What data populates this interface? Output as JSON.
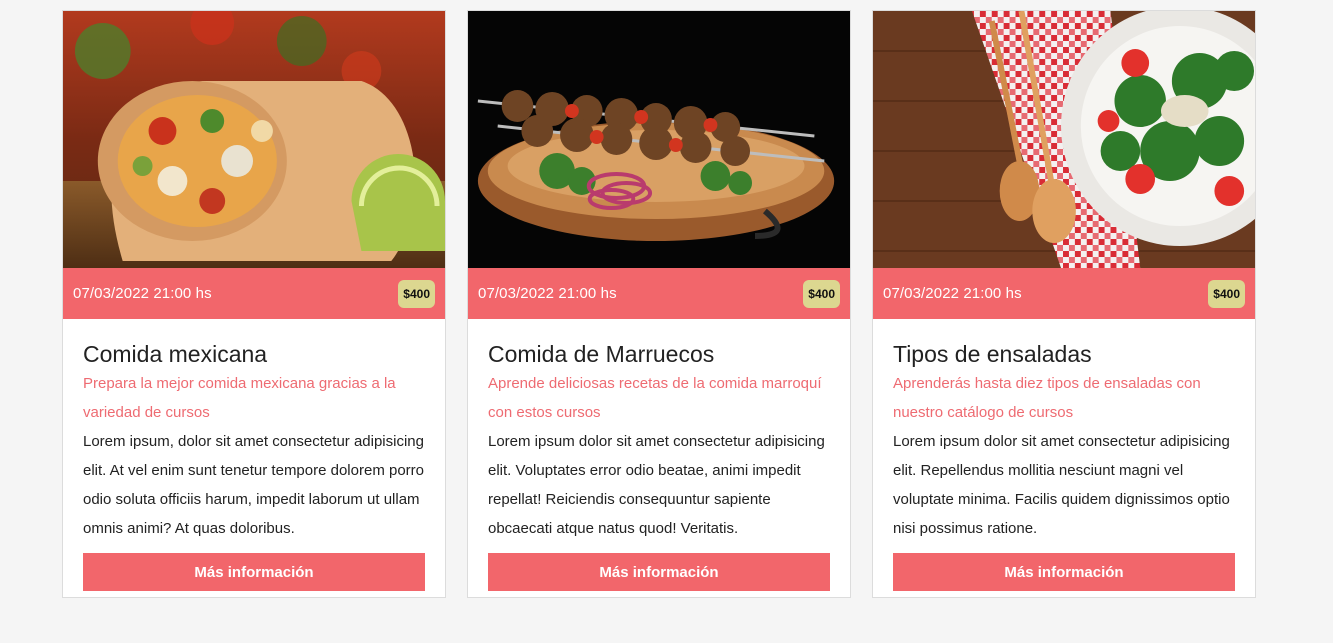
{
  "colors": {
    "accent": "#f2666b",
    "badge": "#dcd790",
    "subtitle": "#ee6b72"
  },
  "cards": [
    {
      "image": "burrito-photo",
      "date": "07/03/2022 21:00 hs",
      "price": "$400",
      "title": "Comida mexicana",
      "subtitle": "Prepara la mejor comida mexicana gracias a la variedad de cursos",
      "description": "Lorem ipsum, dolor sit amet consectetur adipisicing elit. At vel enim sunt tenetur tempore dolorem porro odio soluta officiis harum, impedit laborum ut ullam omnis animi? At quas doloribus.",
      "button": "Más información"
    },
    {
      "image": "kebab-photo",
      "date": "07/03/2022 21:00 hs",
      "price": "$400",
      "title": "Comida de Marruecos",
      "subtitle": "Aprende deliciosas recetas de la comida marroquí con estos cursos",
      "description": "Lorem ipsum dolor sit amet consectetur adipisicing elit. Voluptates error odio beatae, animi impedit repellat! Reiciendis consequuntur sapiente obcaecati atque natus quod! Veritatis.",
      "button": "Más información"
    },
    {
      "image": "salad-photo",
      "date": "07/03/2022 21:00 hs",
      "price": "$400",
      "title": "Tipos de ensaladas",
      "subtitle": "Aprenderás hasta diez tipos de ensaladas con nuestro catálogo de cursos",
      "description": "Lorem ipsum dolor sit amet consectetur adipisicing elit. Repellendus mollitia nesciunt magni vel voluptate minima. Facilis quidem dignissimos optio nisi possimus ratione.",
      "button": "Más información"
    }
  ]
}
